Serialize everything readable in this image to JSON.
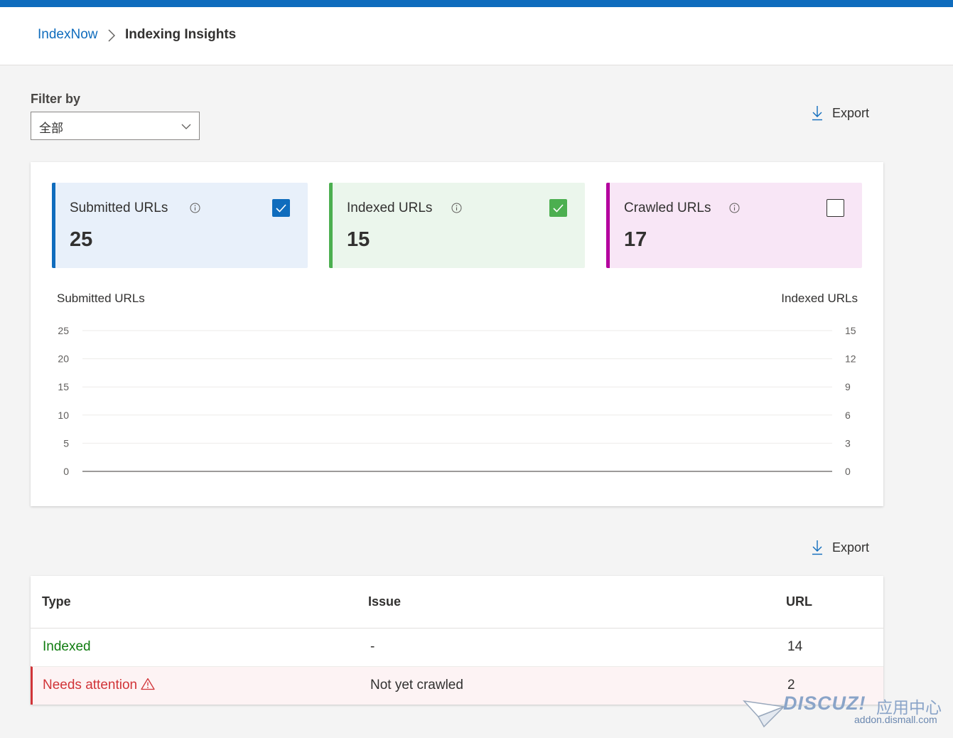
{
  "colors": {
    "accent": "#0f6cbd",
    "submitted": "#0f6cbd",
    "indexed": "#4caf50",
    "crawled": "#b4009e",
    "submitted_bg": "#e8f0fa",
    "indexed_bg": "#ebf6ec",
    "crawled_bg": "#f8e6f6",
    "indexed_text": "#107c10",
    "attention_text": "#d13438"
  },
  "breadcrumb": {
    "link": "IndexNow",
    "current": "Indexing Insights"
  },
  "filter": {
    "label": "Filter by",
    "value": "全部"
  },
  "export_label": "Export",
  "cards": [
    {
      "title": "Submitted URLs",
      "value": "25",
      "checked": true,
      "info_icon": "info-icon"
    },
    {
      "title": "Indexed URLs",
      "value": "15",
      "checked": true,
      "info_icon": "info-icon"
    },
    {
      "title": "Crawled URLs",
      "value": "17",
      "checked": false,
      "info_icon": "info-icon"
    }
  ],
  "chart_data": {
    "type": "line",
    "ylabel_left": "Submitted URLs",
    "ylabel_right": "Indexed URLs",
    "y_left_ticks": [
      "25",
      "20",
      "15",
      "10",
      "5",
      "0"
    ],
    "y_right_ticks": [
      "15",
      "12",
      "9",
      "6",
      "3",
      "0"
    ],
    "ylim_left": [
      0,
      25
    ],
    "ylim_right": [
      0,
      15
    ],
    "grid": true,
    "series": []
  },
  "table": {
    "headers": [
      "Type",
      "Issue",
      "URL"
    ],
    "rows": [
      {
        "type": "Indexed",
        "issue": "-",
        "url": "14",
        "status": "ok"
      },
      {
        "type": "Needs attention",
        "issue": "Not yet crawled",
        "url": "2",
        "status": "warning",
        "icon": "warning-icon"
      }
    ]
  },
  "watermark": {
    "brand": "DISCUZ!",
    "cn": "应用中心",
    "url": "addon.dismall.com"
  }
}
